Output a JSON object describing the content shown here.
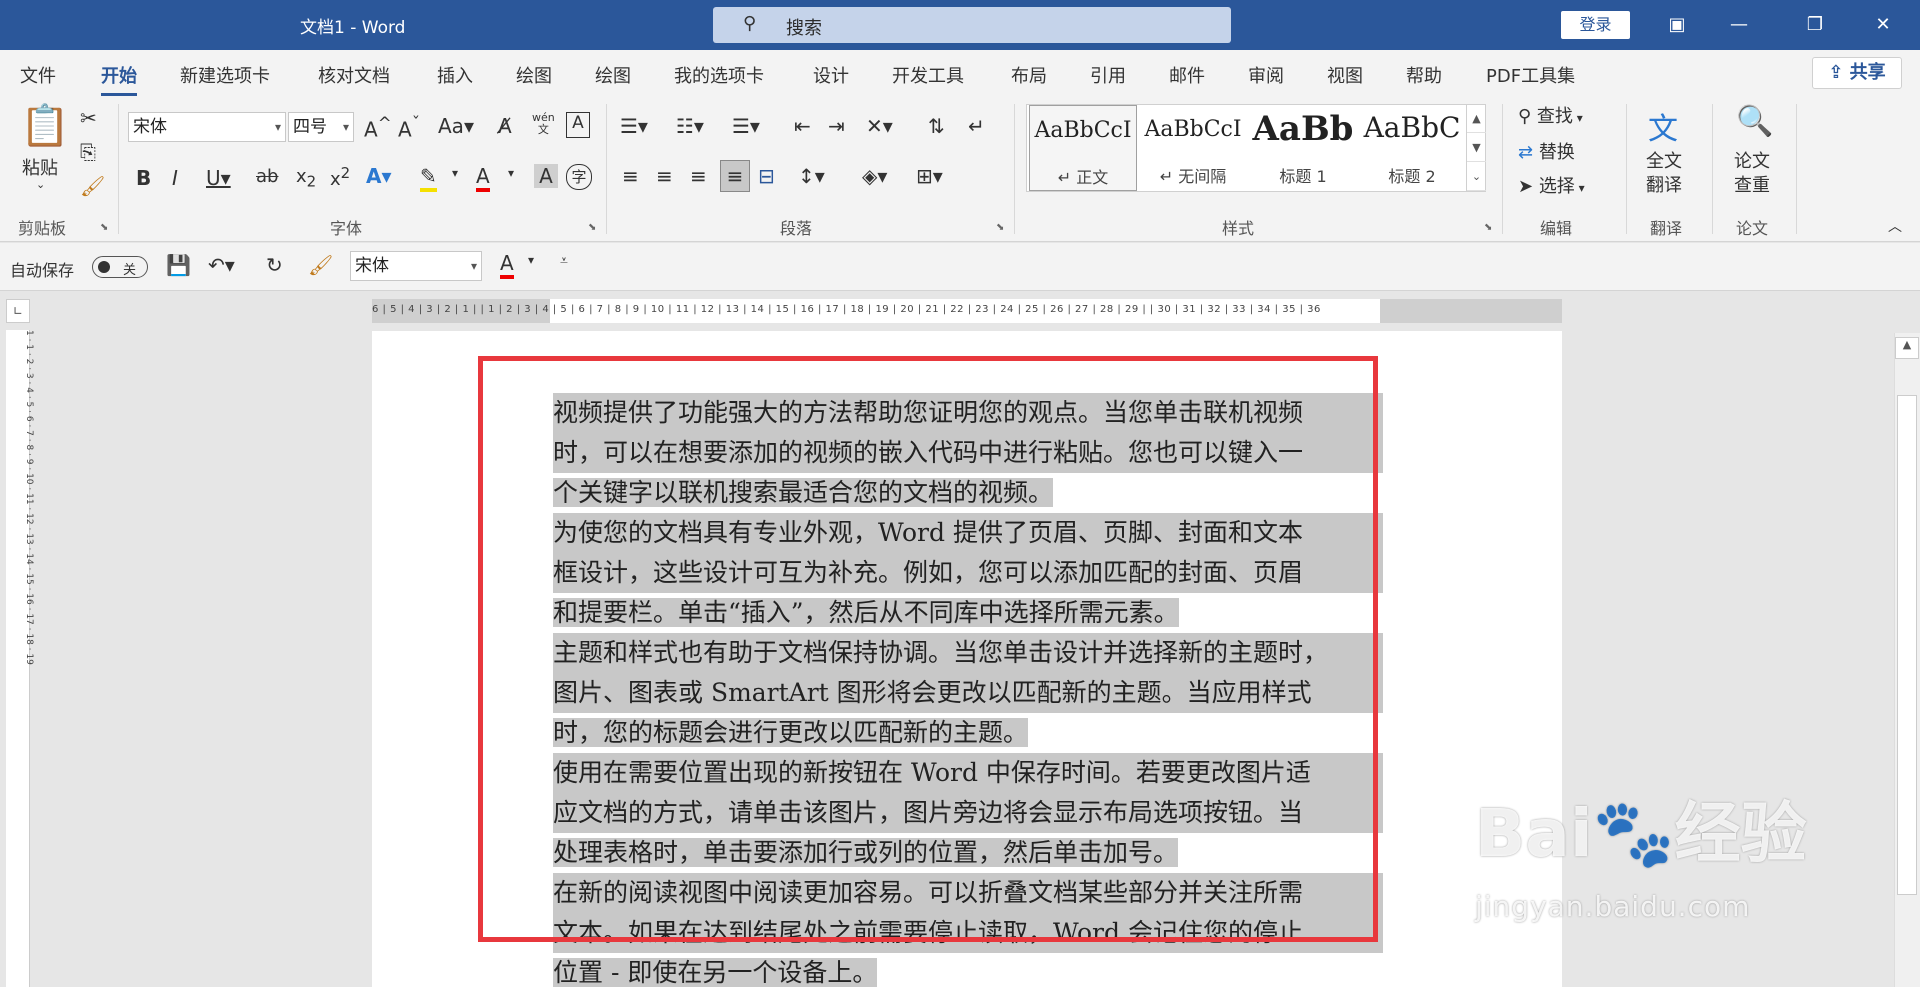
{
  "titlebar": {
    "title": "文档1  -  Word",
    "search_placeholder": "搜索",
    "login": "登录"
  },
  "menu": {
    "tabs": [
      "文件",
      "开始",
      "新建选项卡",
      "核对文档",
      "插入",
      "绘图",
      "绘图",
      "我的选项卡",
      "设计",
      "开发工具",
      "布局",
      "引用",
      "邮件",
      "审阅",
      "视图",
      "帮助",
      "PDF工具集"
    ],
    "active": "开始",
    "share": "共享"
  },
  "ribbon": {
    "clipboard": {
      "paste": "粘贴",
      "label": "剪贴板"
    },
    "font": {
      "name": "宋体",
      "size": "四号",
      "label": "字体",
      "pinyin": "wén"
    },
    "paragraph": {
      "label": "段落"
    },
    "styles": {
      "label": "样式",
      "items": [
        {
          "preview": "AaBbCcI",
          "name": "↵ 正文"
        },
        {
          "preview": "AaBbCcI",
          "name": "↵ 无间隔"
        },
        {
          "preview": "AaBb",
          "name": "标题 1"
        },
        {
          "preview": "AaBbC",
          "name": "标题 2"
        }
      ]
    },
    "editing": {
      "find": "查找",
      "replace": "替换",
      "select": "选择",
      "label": "编辑"
    },
    "translate": {
      "button": "全文\n翻译",
      "label": "翻译"
    },
    "thesis": {
      "button": "论文\n查重",
      "label": "论文"
    }
  },
  "qat": {
    "autosave_label": "自动保存",
    "toggle_state": "关",
    "font": "宋体"
  },
  "ruler": {
    "h_numbers": "6 | 5 | 4 | 3 | 2 | 1 |    | 1 | 2 | 3 | 4 | 5 | 6 | 7 | 8 | 9 | 10 | 11 | 12 | 13 | 14 | 15 | 16 | 17 | 18 | 19 | 20 | 21 | 22 | 23 | 24 | 25 | 26 | 27 | 28 | 29 |    | 30 | 31 | 32 | 33 | 34 | 35 | 36",
    "v_numbers": "1 · 1 · 2 · 3 · 4 · 5 · 6 · 7 · 8 · 9 · 10 · 11 · 12 · 13 · 14 · 15 · 16 · 17 · 18 · 19"
  },
  "document": {
    "paragraphs": [
      {
        "lines": [
          "视频提供了功能强大的方法帮助您证明您的观点。当您单击联机视频",
          "时，可以在想要添加的视频的嵌入代码中进行粘贴。您也可以键入一",
          "个关键字以联机搜索最适合您的文档的视频。"
        ]
      },
      {
        "lines": [
          "为使您的文档具有专业外观，Word 提供了页眉、页脚、封面和文本",
          "框设计，这些设计可互为补充。例如，您可以添加匹配的封面、页眉",
          "和提要栏。单击“插入”，然后从不同库中选择所需元素。"
        ]
      },
      {
        "lines": [
          "主题和样式也有助于文档保持协调。当您单击设计并选择新的主题时，",
          "图片、图表或 SmartArt 图形将会更改以匹配新的主题。当应用样式",
          "时，您的标题会进行更改以匹配新的主题。"
        ]
      },
      {
        "lines": [
          "使用在需要位置出现的新按钮在 Word 中保存时间。若要更改图片适",
          "应文档的方式，请单击该图片，图片旁边将会显示布局选项按钮。当",
          "处理表格时，单击要添加行或列的位置，然后单击加号。"
        ]
      },
      {
        "lines": [
          "在新的阅读视图中阅读更加容易。可以折叠文档某些部分并关注所需",
          "文本。如果在达到结尾处之前需要停止读取，Word 会记住您的停止",
          "位置 - 即使在另一个设备上。"
        ]
      }
    ]
  },
  "watermark": {
    "brand": "Bai",
    "brand2": "经验",
    "url": "jingyan.baidu.com"
  },
  "colors": {
    "accent": "#2b579a",
    "highlight_box": "#e8383d",
    "selection": "#c8c8c8"
  }
}
